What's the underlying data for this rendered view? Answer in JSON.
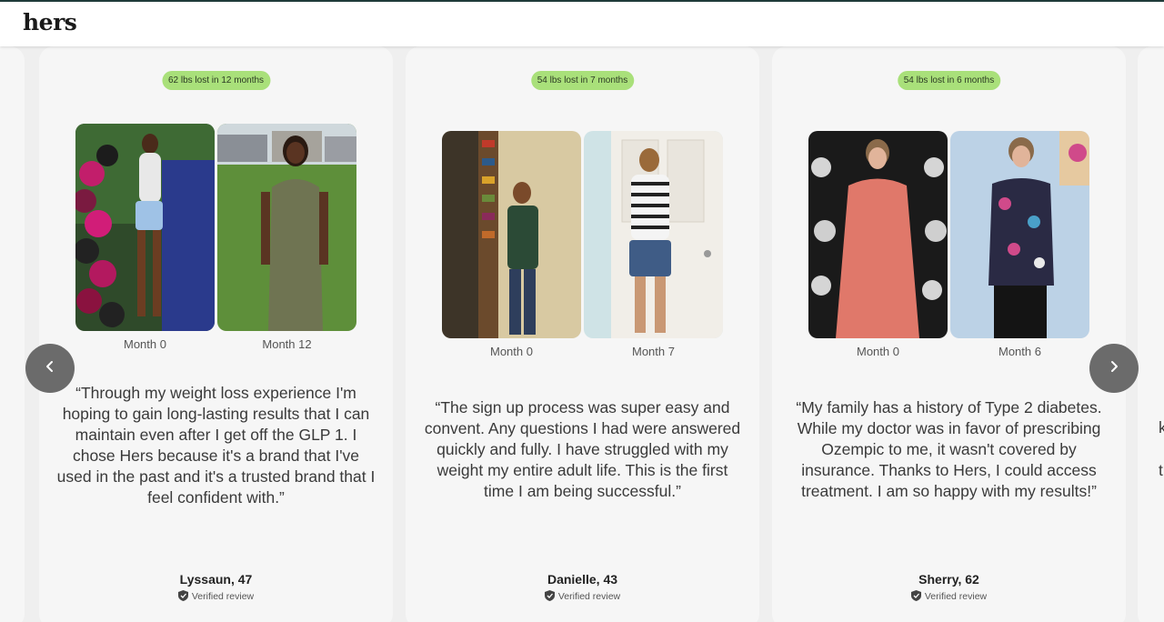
{
  "header": {
    "logo": "hers"
  },
  "carousel": {
    "prev_label": "Previous",
    "next_label": "Next",
    "cards": [
      {
        "badge": "62 lbs lost in 12 months",
        "before_label": "Month 0",
        "after_label": "Month 12",
        "quote": "“Through my weight loss experience I'm hoping to gain long-lasting results that I can maintain even after I get off the GLP 1. I chose Hers because it's a brand that I've used in the past and it's a trusted brand that I feel confident with.”",
        "name": "Lyssaun, 47",
        "verified": "Verified review"
      },
      {
        "badge": "54 lbs lost in 7 months",
        "before_label": "Month 0",
        "after_label": "Month 7",
        "quote": "“The sign up process was super easy and convent. Any questions I had were answered quickly and fully. I have struggled with my weight my entire adult life. This is the first time I am being successful.”",
        "name": "Danielle, 43",
        "verified": "Verified review"
      },
      {
        "badge": "54 lbs lost in 6 months",
        "before_label": "Month 0",
        "after_label": "Month 6",
        "quote": "“My family has a history of Type 2 diabetes. While my doctor was in favor of prescribing Ozempic to me, it wasn't covered by insurance. Thanks to Hers, I could access treatment. I am so happy with my results!”",
        "name": "Sherry, 62",
        "verified": "Verified review"
      }
    ],
    "peek_fragments": [
      "k",
      "t"
    ]
  },
  "colors": {
    "badge": "#a9e07a",
    "nav_button": "#6b6b6b",
    "card": "#f6f6f6",
    "topbar_border": "#1f3b3a"
  },
  "icons": {
    "prev": "chevron-left-icon",
    "next": "chevron-right-icon",
    "verified": "shield-check-icon"
  }
}
